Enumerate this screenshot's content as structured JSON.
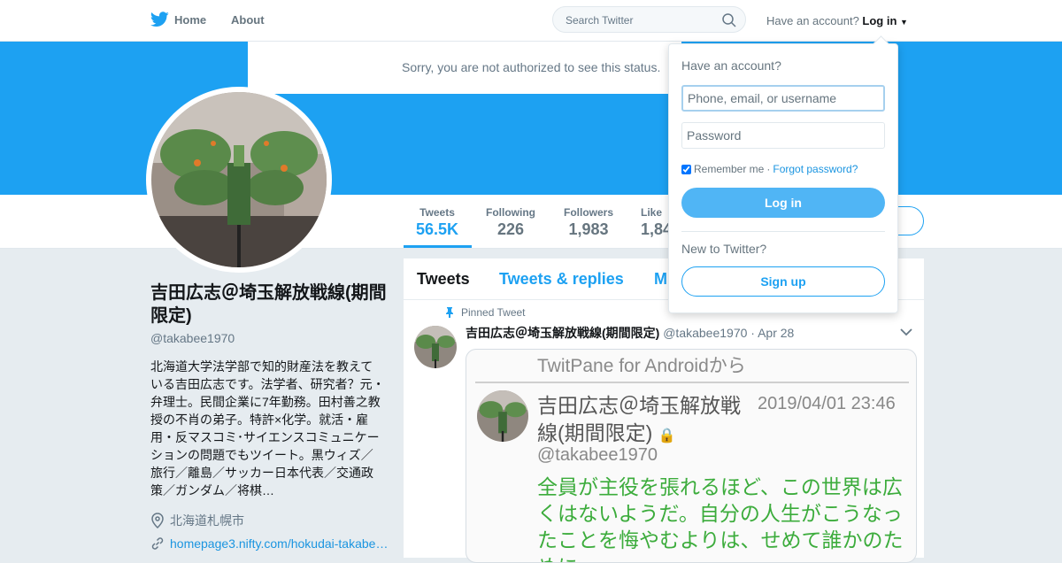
{
  "nav": {
    "home": "Home",
    "about": "About"
  },
  "search": {
    "placeholder": "Search Twitter"
  },
  "account": {
    "prompt": "Have an account?",
    "login": "Log in"
  },
  "notice": "Sorry, you are not authorized to see this status.",
  "stats": [
    {
      "label": "Tweets",
      "value": "56.5K"
    },
    {
      "label": "Following",
      "value": "226"
    },
    {
      "label": "Followers",
      "value": "1,983"
    },
    {
      "label": "Like",
      "value": "1,84"
    }
  ],
  "profile": {
    "name": "吉田広志＠埼玉解放戦線(期間限定)",
    "handle": "@takabee1970",
    "bio": "北海道大学法学部で知的財産法を教えている吉田広志です。法学者、研究者？元・弁理士。民間企業に7年勤務。田村善之教授の不肖の弟子。特許×化学。就活・雇用・反マスコミ･サイエンスコミュニケーションの問題でもツイート。黒ウィズ／旅行／離島／サッカー日本代表／交通政策／ガンダム／将棋…",
    "location": "北海道札幌市",
    "url": "homepage3.nifty.com/hokudai-takabe…"
  },
  "timeline_tabs": [
    "Tweets",
    "Tweets & replies",
    "M"
  ],
  "tweet": {
    "pinned": "Pinned Tweet",
    "name": "吉田広志＠埼玉解放戦線(期間限定)",
    "handle": "@takabee1970",
    "date": "· Apr 28",
    "media": {
      "source": "TwitPane for Androidから",
      "name": "吉田広志＠埼玉解放戦線(期間限定)",
      "date": "2019/04/01 23:46",
      "handle": "@takabee1970",
      "text": "全員が主役を張れるほど、この世界は広くはないようだ。自分の人生がこうなったことを悔やむよりは、せめて誰かのために"
    }
  },
  "login_panel": {
    "title": "Have an account?",
    "username_placeholder": "Phone, email, or username",
    "password_placeholder": "Password",
    "remember": "Remember me",
    "separator": "·",
    "forgot": "Forgot password?",
    "login_button": "Log in",
    "new_prompt": "New to Twitter?",
    "signup_button": "Sign up"
  },
  "colors": {
    "brand": "#1da1f2",
    "banner": "#1da1f2",
    "link": "#1b95e0"
  }
}
